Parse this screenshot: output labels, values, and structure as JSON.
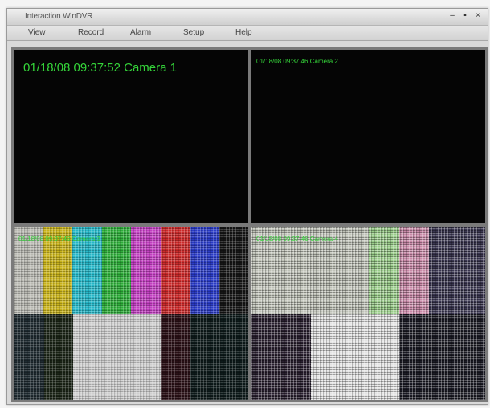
{
  "window": {
    "title": "Interaction WinDVR",
    "controls": [
      "minimize-icon",
      "maximize-icon",
      "close-icon"
    ]
  },
  "menu": {
    "items": [
      "View",
      "Record",
      "Alarm",
      "Setup",
      "Help"
    ]
  },
  "cameras": [
    {
      "overlay": "01/18/08 09:37:52 Camera 1"
    },
    {
      "overlay": "01/18/08 09:37:46 Camera 2"
    },
    {
      "overlay": "01/18/08 09:37:46 Camera 3"
    },
    {
      "overlay": "01/18/08 09:37:46 Camera 4"
    }
  ],
  "colors": {
    "osd": "#35d53a",
    "pane_bg": "#050505",
    "divider": "#7a7a7a"
  }
}
